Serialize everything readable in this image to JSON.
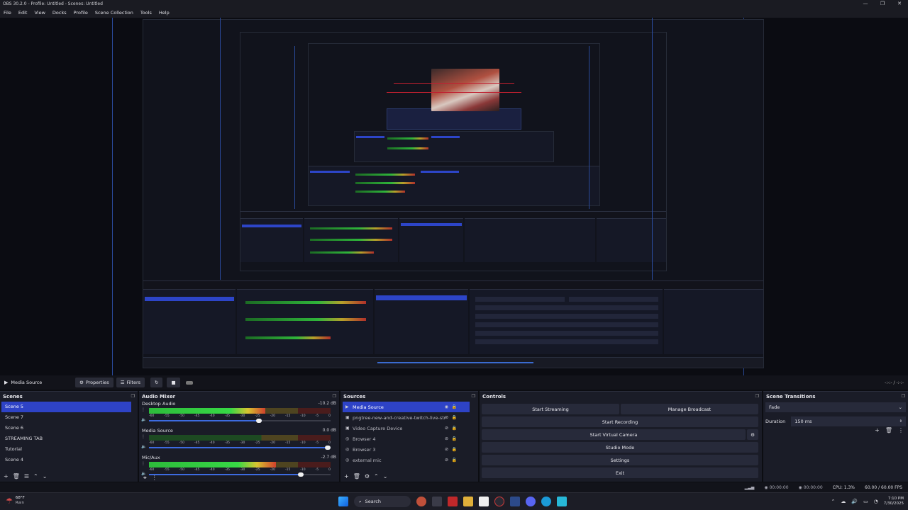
{
  "window": {
    "title": "OBS 30.2.0 - Profile: Untitled - Scenes: Untitled",
    "controls": [
      "—",
      "❐",
      "✕"
    ]
  },
  "menu": [
    "File",
    "Edit",
    "View",
    "Docks",
    "Profile",
    "Scene Collection",
    "Tools",
    "Help"
  ],
  "source_toolbar": {
    "current_source": "Media Source",
    "properties_label": "Properties",
    "filters_label": "Filters",
    "time": "-:-:- / -:-:-"
  },
  "scenes": {
    "title": "Scenes",
    "items": [
      "Scene 5",
      "Scene 7",
      "Scene 6",
      "STREAMING TAB",
      "Tutorial",
      "Scene 4"
    ],
    "selected_index": 0
  },
  "audio_mixer": {
    "title": "Audio Mixer",
    "scale": [
      "-60",
      "-55",
      "-50",
      "-45",
      "-40",
      "-35",
      "-30",
      "-25",
      "-20",
      "-15",
      "-10",
      "-5",
      "0"
    ],
    "channels": [
      {
        "name": "Desktop Audio",
        "db": "-10.2 dB",
        "level": 0.64,
        "volume": 0.62
      },
      {
        "name": "Media Source",
        "db": "0.0 dB",
        "level": 0.0,
        "volume": 1.0
      },
      {
        "name": "Mic/Aux",
        "db": "-2.7 dB",
        "level": 0.7,
        "volume": 0.85
      }
    ]
  },
  "sources": {
    "title": "Sources",
    "items": [
      {
        "name": "Media Source",
        "type_icon": "▶"
      },
      {
        "name": "pngtree-new-and-creative-twitch-live-stream",
        "type_icon": "▣"
      },
      {
        "name": "Video Capture Device",
        "type_icon": "▣"
      },
      {
        "name": "Browser 4",
        "type_icon": "◎"
      },
      {
        "name": "Browser 3",
        "type_icon": "◎"
      },
      {
        "name": "external mic",
        "type_icon": "◎"
      }
    ],
    "selected_index": 0
  },
  "controls": {
    "title": "Controls",
    "start_streaming": "Start Streaming",
    "manage_broadcast": "Manage Broadcast",
    "start_recording": "Start Recording",
    "start_virtual_camera": "Start Virtual Camera",
    "studio_mode": "Studio Mode",
    "settings": "Settings",
    "exit": "Exit"
  },
  "transitions": {
    "title": "Scene Transitions",
    "selected": "Fade",
    "duration_label": "Duration",
    "duration_value": "150 ms"
  },
  "status": {
    "stream_time": "00:00:00",
    "rec_time": "00:00:00",
    "cpu": "CPU: 1.3%",
    "fps": "60.00 / 60.00 FPS"
  },
  "taskbar": {
    "weather_temp": "68°F",
    "weather_desc": "Rain",
    "search": "Search",
    "time": "7:10 PM",
    "date": "7/30/2025"
  },
  "colors": {
    "selection": "#2e43c6",
    "panel": "#1a1c27",
    "background": "#0c0d12"
  }
}
